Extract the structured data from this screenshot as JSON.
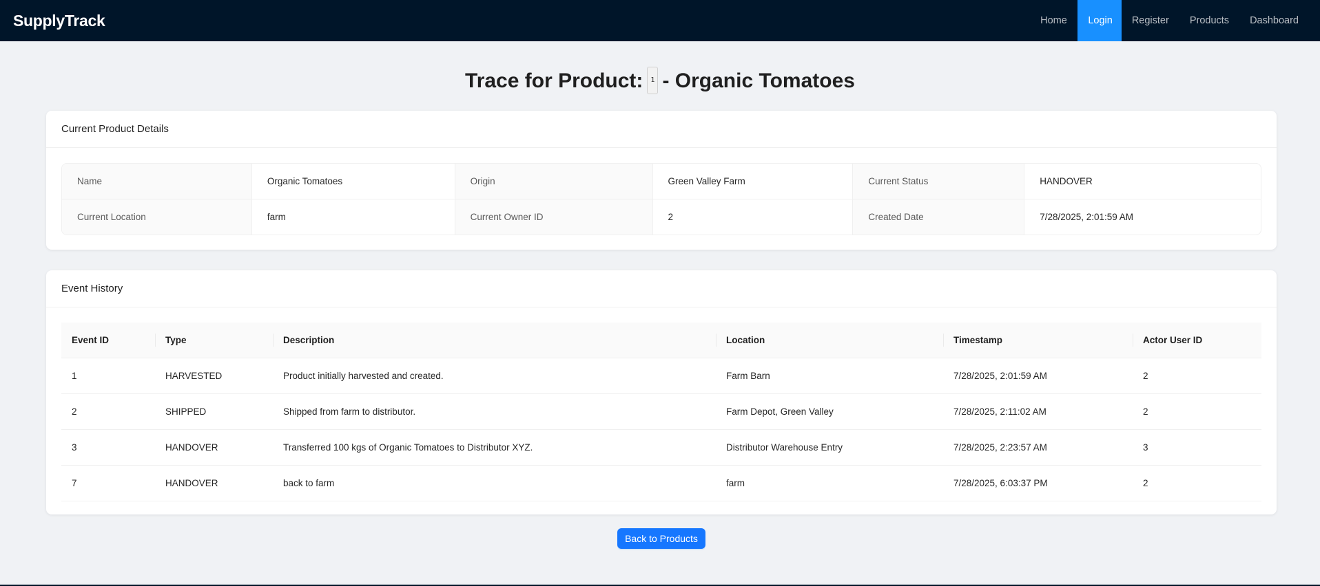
{
  "brand": "SupplyTrack",
  "nav": {
    "items": [
      {
        "label": "Home",
        "active": false
      },
      {
        "label": "Login",
        "active": true
      },
      {
        "label": "Register",
        "active": false
      },
      {
        "label": "Products",
        "active": false
      },
      {
        "label": "Dashboard",
        "active": false
      }
    ]
  },
  "title": {
    "prefix": "Trace for Product:",
    "product_id": "1",
    "suffix": "- Organic Tomatoes"
  },
  "details": {
    "heading": "Current Product Details",
    "rows": [
      [
        {
          "label": "Name",
          "value": "Organic Tomatoes"
        },
        {
          "label": "Origin",
          "value": "Green Valley Farm"
        },
        {
          "label": "Current Status",
          "value": "HANDOVER"
        }
      ],
      [
        {
          "label": "Current Location",
          "value": "farm"
        },
        {
          "label": "Current Owner ID",
          "value": "2"
        },
        {
          "label": "Created Date",
          "value": "7/28/2025, 2:01:59 AM"
        }
      ]
    ]
  },
  "events": {
    "heading": "Event History",
    "columns": [
      "Event ID",
      "Type",
      "Description",
      "Location",
      "Timestamp",
      "Actor User ID"
    ],
    "rows": [
      [
        "1",
        "HARVESTED",
        "Product initially harvested and created.",
        "Farm Barn",
        "7/28/2025, 2:01:59 AM",
        "2"
      ],
      [
        "2",
        "SHIPPED",
        "Shipped from farm to distributor.",
        "Farm Depot, Green Valley",
        "7/28/2025, 2:11:02 AM",
        "2"
      ],
      [
        "3",
        "HANDOVER",
        "Transferred 100 kgs of Organic Tomatoes to Distributor XYZ.",
        "Distributor Warehouse Entry",
        "7/28/2025, 2:23:57 AM",
        "3"
      ],
      [
        "7",
        "HANDOVER",
        "back to farm",
        "farm",
        "7/28/2025, 6:03:37 PM",
        "2"
      ]
    ]
  },
  "back_button": "Back to Products",
  "colors": {
    "header_bg": "#001529",
    "active_nav": "#1890ff",
    "primary_button": "#1677ff",
    "page_bg": "#f0f2f5"
  }
}
